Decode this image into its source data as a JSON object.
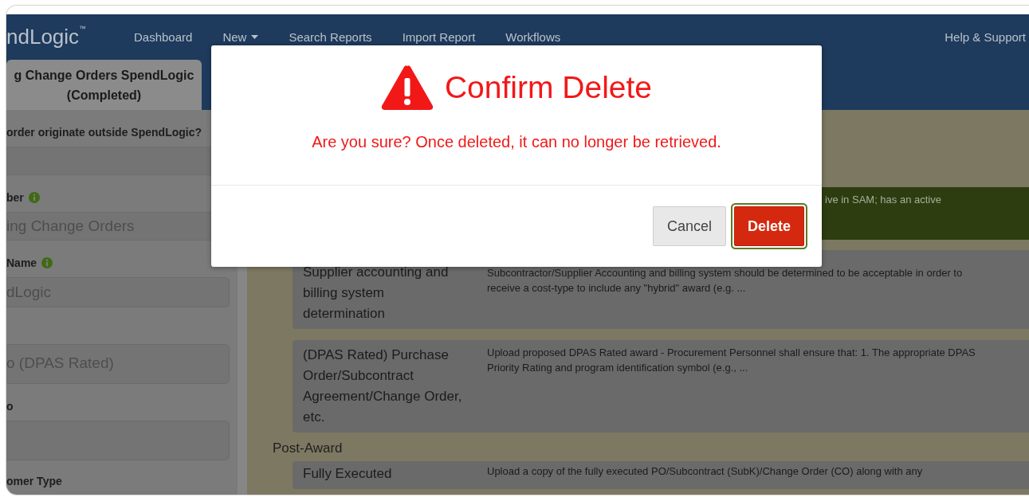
{
  "nav": {
    "logo": "ndLogic",
    "logo_mark": "™",
    "items": [
      {
        "label": "Dashboard",
        "dropdown": false
      },
      {
        "label": "New",
        "dropdown": true
      },
      {
        "label": "Search Reports",
        "dropdown": false
      },
      {
        "label": "Import Report",
        "dropdown": false
      },
      {
        "label": "Workflows",
        "dropdown": false
      }
    ],
    "help": "Help & Support"
  },
  "tab": {
    "label": "g Change Orders SpendLogic (Completed)"
  },
  "form": {
    "fields": [
      {
        "label": "order originate outside SpendLogic?",
        "info": false,
        "kind": "select"
      },
      {
        "label": "ber",
        "info": true,
        "kind": "input",
        "value": "ing Change Orders"
      },
      {
        "label": "Name",
        "info": true,
        "kind": "rounded",
        "value": "dLogic"
      },
      {
        "kind": "textarea",
        "value": "o (DPAS Rated)"
      },
      {
        "label": "o",
        "info": false,
        "kind": "textarea"
      },
      {
        "label": "omer Type",
        "info": false,
        "kind": "label"
      }
    ]
  },
  "content": {
    "items": [
      {
        "kind": "alert",
        "description": "ive in SAM; has an active"
      },
      {
        "kind": "card",
        "title": "Supplier accounting and billing system determination",
        "description": "Subcontractor/Supplier Accounting and billing system should be determined to be acceptable in order to receive a cost-type to include any \"hybrid\" award (e.g. ..."
      },
      {
        "kind": "card",
        "title": "(DPAS Rated) Purchase Order/Subcontract Agreement/Change Order, etc.",
        "description": "Upload proposed DPAS Rated award - Procurement Personnel shall ensure that: 1. The appropriate DPAS Priority Rating and program identification symbol (e.g., ..."
      },
      {
        "kind": "heading",
        "title": "Post-Award"
      },
      {
        "kind": "card",
        "title": "Fully Executed",
        "description": "Upload a copy of the fully executed PO/Subcontract (SubK)/Change Order (CO) along with any"
      }
    ]
  },
  "modal": {
    "title": "Confirm Delete",
    "message": "Are you sure? Once deleted, it can no longer be retrieved.",
    "buttons": [
      {
        "label": "Cancel",
        "kind": "default",
        "focused": false
      },
      {
        "label": "Delete",
        "kind": "danger",
        "focused": true
      }
    ]
  }
}
